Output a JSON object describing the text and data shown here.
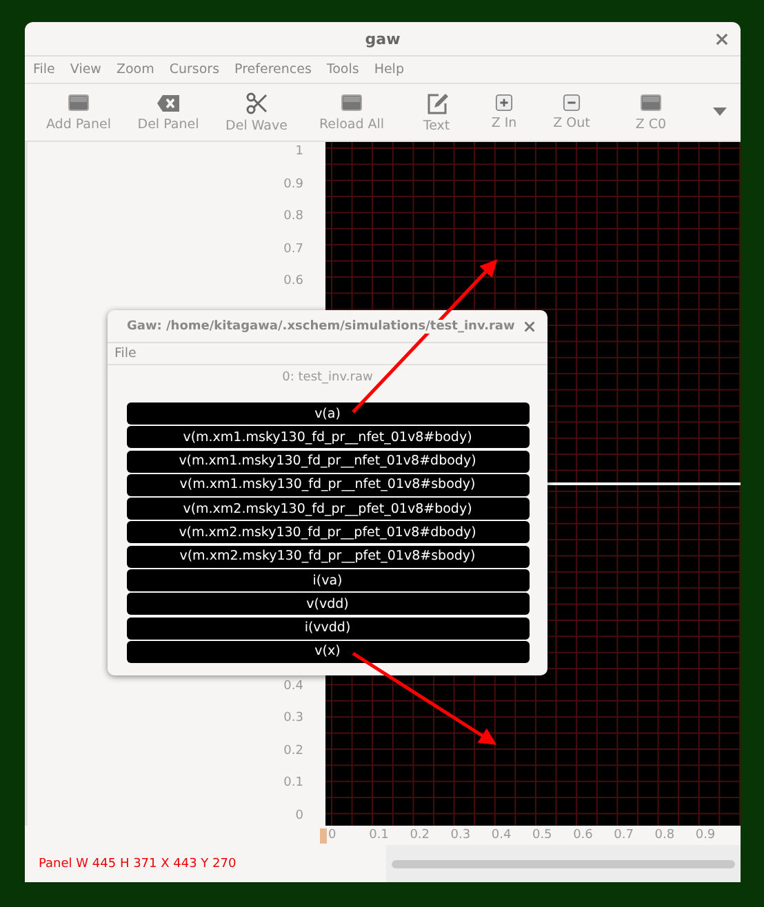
{
  "window": {
    "title": "gaw"
  },
  "menu": [
    "File",
    "View",
    "Zoom",
    "Cursors",
    "Preferences",
    "Tools",
    "Help"
  ],
  "toolbar": [
    {
      "label": "Add Panel",
      "kind": "panel"
    },
    {
      "label": "Del Panel",
      "kind": "backspace"
    },
    {
      "label": "Del Wave",
      "kind": "scissors"
    },
    {
      "label": "Reload All",
      "kind": "panel"
    },
    {
      "label": "Text",
      "kind": "edit"
    },
    {
      "label": "Z In",
      "kind": "plus"
    },
    {
      "label": "Z Out",
      "kind": "minus"
    },
    {
      "label": "Z C0",
      "kind": "panel"
    }
  ],
  "panels": [
    {
      "yticks": [
        "1",
        "0.9",
        "0.8",
        "0.7",
        "0.6"
      ]
    },
    {
      "yticks": [
        "0.4",
        "0.3",
        "0.2",
        "0.1",
        "0"
      ]
    }
  ],
  "xticks": [
    "0",
    "0.1",
    "0.2",
    "0.3",
    "0.4",
    "0.5",
    "0.6",
    "0.7",
    "0.8",
    "0.9"
  ],
  "status": "Panel W 445 H 371 X 443 Y 270",
  "dialog": {
    "title": "Gaw: /home/kitagawa/.xschem/simulations/test_inv.raw",
    "menu": [
      "File"
    ],
    "file": "0: test_inv.raw",
    "signals": [
      "v(a)",
      "v(m.xm1.msky130_fd_pr__nfet_01v8#body)",
      "v(m.xm1.msky130_fd_pr__nfet_01v8#dbody)",
      "v(m.xm1.msky130_fd_pr__nfet_01v8#sbody)",
      "v(m.xm2.msky130_fd_pr__pfet_01v8#body)",
      "v(m.xm2.msky130_fd_pr__pfet_01v8#dbody)",
      "v(m.xm2.msky130_fd_pr__pfet_01v8#sbody)",
      "i(va)",
      "v(vdd)",
      "i(vvdd)",
      "v(x)"
    ]
  }
}
